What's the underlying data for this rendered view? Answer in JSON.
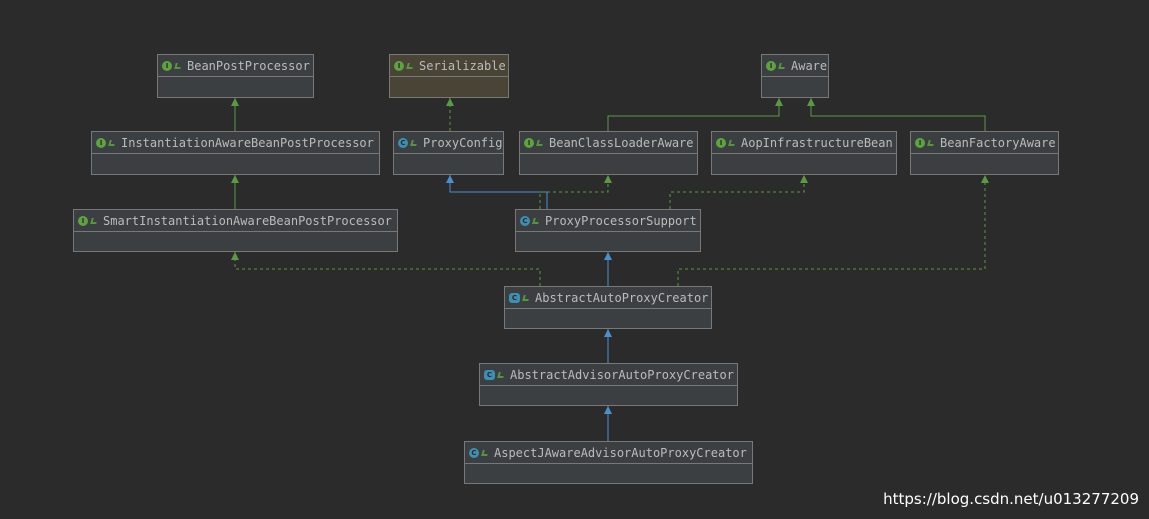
{
  "diagram": {
    "nodes": [
      {
        "id": "BeanPostProcessor",
        "label": "BeanPostProcessor",
        "kind": "interface",
        "icon": "interface-icon"
      },
      {
        "id": "Serializable",
        "label": "Serializable",
        "kind": "interface",
        "icon": "interface-icon"
      },
      {
        "id": "Aware",
        "label": "Aware",
        "kind": "interface",
        "icon": "interface-icon"
      },
      {
        "id": "InstantiationAwareBeanPostProcessor",
        "label": "InstantiationAwareBeanPostProcessor",
        "kind": "interface",
        "icon": "interface-icon"
      },
      {
        "id": "ProxyConfig",
        "label": "ProxyConfig",
        "kind": "class",
        "icon": "class-icon"
      },
      {
        "id": "BeanClassLoaderAware",
        "label": "BeanClassLoaderAware",
        "kind": "interface",
        "icon": "interface-icon"
      },
      {
        "id": "AopInfrastructureBean",
        "label": "AopInfrastructureBean",
        "kind": "interface",
        "icon": "interface-icon"
      },
      {
        "id": "BeanFactoryAware",
        "label": "BeanFactoryAware",
        "kind": "interface",
        "icon": "interface-icon"
      },
      {
        "id": "SmartInstantiationAwareBeanPostProcessor",
        "label": "SmartInstantiationAwareBeanPostProcessor",
        "kind": "interface",
        "icon": "interface-icon"
      },
      {
        "id": "ProxyProcessorSupport",
        "label": "ProxyProcessorSupport",
        "kind": "class",
        "icon": "class-icon"
      },
      {
        "id": "AbstractAutoProxyCreator",
        "label": "AbstractAutoProxyCreator",
        "kind": "abstract",
        "icon": "abstract-class-icon"
      },
      {
        "id": "AbstractAdvisorAutoProxyCreator",
        "label": "AbstractAdvisorAutoProxyCreator",
        "kind": "abstract",
        "icon": "abstract-class-icon"
      },
      {
        "id": "AspectJAwareAdvisorAutoProxyCreator",
        "label": "AspectJAwareAdvisorAutoProxyCreator",
        "kind": "class",
        "icon": "class-icon"
      }
    ],
    "edges": [
      {
        "from": "InstantiationAwareBeanPostProcessor",
        "to": "BeanPostProcessor",
        "type": "extends"
      },
      {
        "from": "ProxyConfig",
        "to": "Serializable",
        "type": "implements"
      },
      {
        "from": "BeanClassLoaderAware",
        "to": "Aware",
        "type": "extends"
      },
      {
        "from": "BeanFactoryAware",
        "to": "Aware",
        "type": "extends"
      },
      {
        "from": "SmartInstantiationAwareBeanPostProcessor",
        "to": "InstantiationAwareBeanPostProcessor",
        "type": "extends"
      },
      {
        "from": "ProxyProcessorSupport",
        "to": "ProxyConfig",
        "type": "extends-class"
      },
      {
        "from": "ProxyProcessorSupport",
        "to": "BeanClassLoaderAware",
        "type": "implements"
      },
      {
        "from": "ProxyProcessorSupport",
        "to": "AopInfrastructureBean",
        "type": "implements"
      },
      {
        "from": "AbstractAutoProxyCreator",
        "to": "ProxyProcessorSupport",
        "type": "extends-class"
      },
      {
        "from": "AbstractAutoProxyCreator",
        "to": "SmartInstantiationAwareBeanPostProcessor",
        "type": "implements"
      },
      {
        "from": "AbstractAutoProxyCreator",
        "to": "BeanFactoryAware",
        "type": "implements"
      },
      {
        "from": "AbstractAdvisorAutoProxyCreator",
        "to": "AbstractAutoProxyCreator",
        "type": "extends-class"
      },
      {
        "from": "AspectJAwareAdvisorAutoProxyCreator",
        "to": "AbstractAdvisorAutoProxyCreator",
        "type": "extends-class"
      }
    ],
    "colors": {
      "interface_edge": "#5b9a45",
      "class_edge": "#4b8fd1",
      "interface_icon": "#5da33f",
      "class_icon": "#3d8fb3"
    }
  },
  "watermark": "https://blog.csdn.net/u013277209"
}
